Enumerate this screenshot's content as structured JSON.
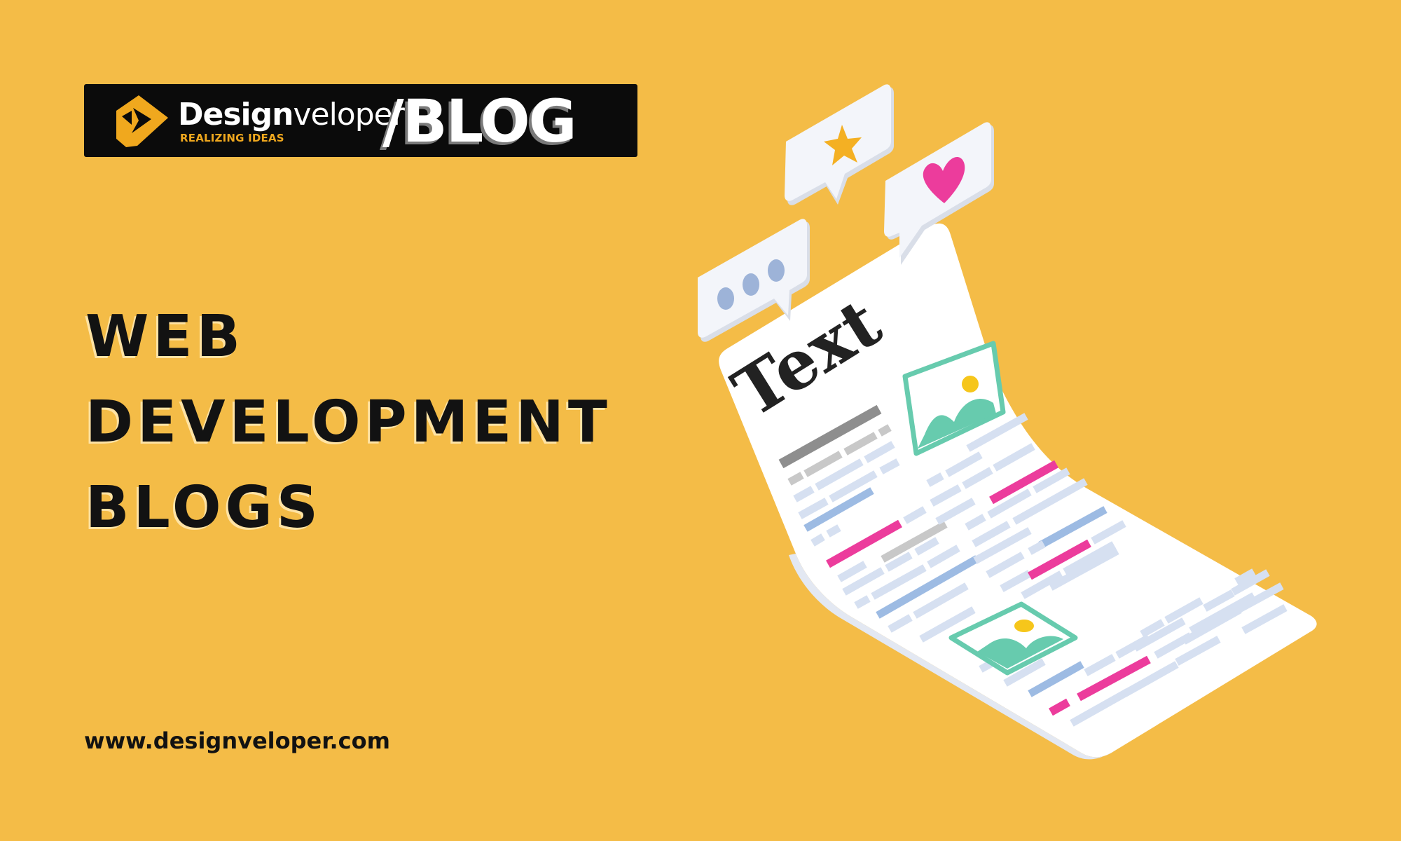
{
  "banner": {
    "brand_bold": "Design",
    "brand_light": "veloper",
    "tagline": "REALIZING IDEAS",
    "section": "/BLOG"
  },
  "headline": {
    "lines": [
      "WEB",
      "DEVELOPMENT",
      "BLOGS"
    ]
  },
  "footer": {
    "url": "www.designveloper.com"
  },
  "illustration": {
    "document_heading": "Text",
    "bubbles": [
      "ellipsis-icon",
      "star-icon",
      "heart-icon"
    ],
    "colors": {
      "background": "#F4BC47",
      "paper": "#FFFFFF",
      "pink": "#EC3C9C",
      "blue": "#9DBBE3",
      "light_blue": "#D6E0F1",
      "gray": "#BDBDBD",
      "teal": "#67CBAE",
      "star": "#F4B023"
    }
  }
}
